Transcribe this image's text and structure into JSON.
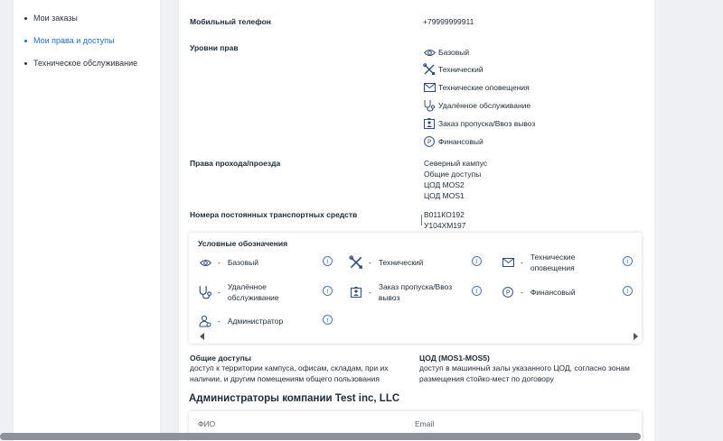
{
  "sidebar": {
    "items": [
      {
        "label": "Мои заказы"
      },
      {
        "label": "Мои права и доступы"
      },
      {
        "label": "Техническое обслуживание"
      }
    ]
  },
  "profile": {
    "phone_label": "Мобильный телефон",
    "phone_value": "+79999999911",
    "rights_label": "Уровни прав",
    "rights": [
      {
        "icon": "eye-icon",
        "label": "Базовый"
      },
      {
        "icon": "tools-icon",
        "label": "Технический"
      },
      {
        "icon": "envelope-icon",
        "label": "Технические оповещения"
      },
      {
        "icon": "stethoscope-icon",
        "label": "Удалённое обслуживание"
      },
      {
        "icon": "pass-icon",
        "label": "Заказ пропуска/Ввоз вывоз"
      },
      {
        "icon": "finance-icon",
        "label": "Финансовый"
      }
    ],
    "access_label": "Права прохода/проезда",
    "access": [
      "Северный кампус",
      "Общие доступы",
      "ЦОД MOS2",
      "ЦОД MOS1"
    ],
    "vehicles_label": "Номера постоянных транспортных средств",
    "vehicles": [
      "В011КО192",
      "У104ХМ197"
    ]
  },
  "legend": {
    "title": "Условные обозначения",
    "dash": "-",
    "info_symbol": "i",
    "items": [
      {
        "icon": "eye-icon",
        "label": "Базовый"
      },
      {
        "icon": "tools-icon",
        "label": "Технический"
      },
      {
        "icon": "envelope-icon",
        "label_line1": "Технические",
        "label_line2": "оповещения"
      },
      {
        "icon": "stethoscope-icon",
        "label_line1": "Удалённое",
        "label_line2": "обслуживание"
      },
      {
        "icon": "pass-icon",
        "label_line1": "Заказ пропуска/Ввоз",
        "label_line2": "вывоз"
      },
      {
        "icon": "finance-icon",
        "label": "Финансовый"
      },
      {
        "icon": "admin-icon",
        "label": "Администратор"
      }
    ]
  },
  "notes": [
    {
      "title": "Общие доступы",
      "line1": "доступ к территории кампуса, офисам, складам, при их",
      "line2": "наличии, и другим помещениям общего пользования"
    },
    {
      "title": "ЦОД (MOS1-MOS5)",
      "line1": "доступ в машинный залы указанного ЦОД, согласно зонам",
      "line2": "размещения стойко-мест по договору"
    }
  ],
  "admins": {
    "title": "Администраторы компании Test inc, LLC",
    "columns": [
      "ФИО",
      "Email"
    ]
  },
  "colors": {
    "accent": "#1f6fc1",
    "icon": "#2f4c7a",
    "info": "#4f79b8"
  }
}
